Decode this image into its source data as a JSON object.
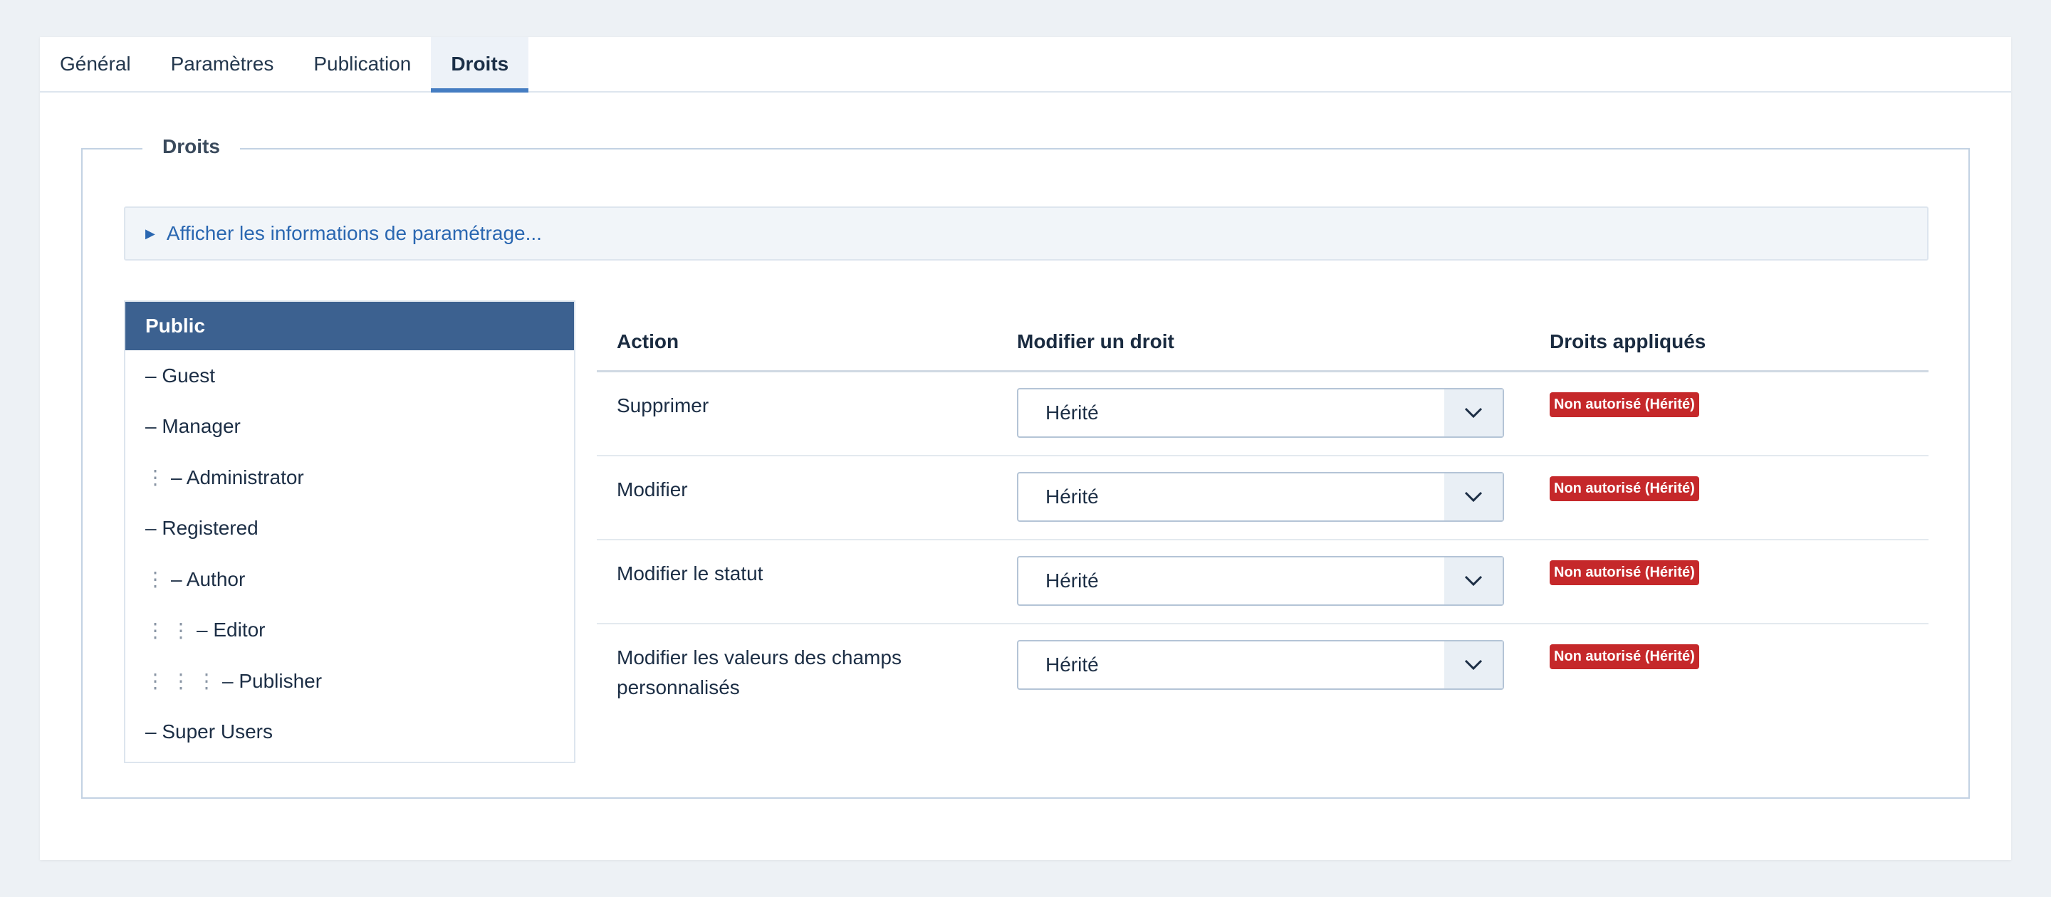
{
  "tabs": [
    {
      "label": "Général"
    },
    {
      "label": "Paramètres"
    },
    {
      "label": "Publication"
    },
    {
      "label": "Droits",
      "active": true
    }
  ],
  "fieldset": {
    "legend": "Droits",
    "info_toggle": "Afficher les informations de paramétrage..."
  },
  "groups": [
    {
      "label": "Public",
      "depth": 0,
      "active": true
    },
    {
      "label": "– Guest",
      "depth": 0
    },
    {
      "label": "– Manager",
      "depth": 0
    },
    {
      "label": "– Administrator",
      "depth": 1
    },
    {
      "label": "– Registered",
      "depth": 0
    },
    {
      "label": "– Author",
      "depth": 1
    },
    {
      "label": "– Editor",
      "depth": 2
    },
    {
      "label": "– Publisher",
      "depth": 3
    },
    {
      "label": "– Super Users",
      "depth": 0
    }
  ],
  "table": {
    "headers": {
      "action": "Action",
      "modify": "Modifier un droit",
      "applied": "Droits appliqués"
    },
    "rows": [
      {
        "action": "Supprimer",
        "setting": "Hérité",
        "applied": "Non autorisé (Hérité)"
      },
      {
        "action": "Modifier",
        "setting": "Hérité",
        "applied": "Non autorisé (Hérité)"
      },
      {
        "action": "Modifier le statut",
        "setting": "Hérité",
        "applied": "Non autorisé (Hérité)"
      },
      {
        "action": "Modifier les valeurs des champs personnalisés",
        "setting": "Hérité",
        "applied": "Non autorisé (Hérité)"
      }
    ]
  },
  "colors": {
    "accent": "#457dc2",
    "active_group": "#3c6190",
    "link": "#2a67b1",
    "denied_badge": "#c5282a"
  },
  "icons": {
    "info_toggle": "triangle-right-icon",
    "select": "chevron-down-icon",
    "indent": "vertical-dots-icon"
  }
}
